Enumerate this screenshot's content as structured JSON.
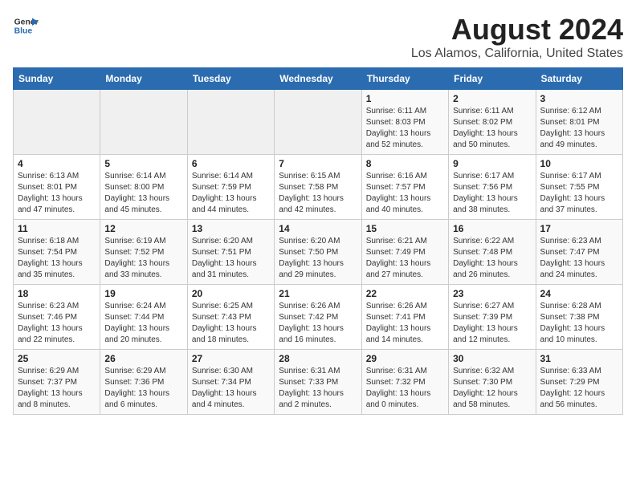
{
  "logo": {
    "line1": "General",
    "line2": "Blue"
  },
  "title": "August 2024",
  "subtitle": "Los Alamos, California, United States",
  "weekdays": [
    "Sunday",
    "Monday",
    "Tuesday",
    "Wednesday",
    "Thursday",
    "Friday",
    "Saturday"
  ],
  "weeks": [
    [
      {
        "day": "",
        "info": ""
      },
      {
        "day": "",
        "info": ""
      },
      {
        "day": "",
        "info": ""
      },
      {
        "day": "",
        "info": ""
      },
      {
        "day": "1",
        "info": "Sunrise: 6:11 AM\nSunset: 8:03 PM\nDaylight: 13 hours\nand 52 minutes."
      },
      {
        "day": "2",
        "info": "Sunrise: 6:11 AM\nSunset: 8:02 PM\nDaylight: 13 hours\nand 50 minutes."
      },
      {
        "day": "3",
        "info": "Sunrise: 6:12 AM\nSunset: 8:01 PM\nDaylight: 13 hours\nand 49 minutes."
      }
    ],
    [
      {
        "day": "4",
        "info": "Sunrise: 6:13 AM\nSunset: 8:01 PM\nDaylight: 13 hours\nand 47 minutes."
      },
      {
        "day": "5",
        "info": "Sunrise: 6:14 AM\nSunset: 8:00 PM\nDaylight: 13 hours\nand 45 minutes."
      },
      {
        "day": "6",
        "info": "Sunrise: 6:14 AM\nSunset: 7:59 PM\nDaylight: 13 hours\nand 44 minutes."
      },
      {
        "day": "7",
        "info": "Sunrise: 6:15 AM\nSunset: 7:58 PM\nDaylight: 13 hours\nand 42 minutes."
      },
      {
        "day": "8",
        "info": "Sunrise: 6:16 AM\nSunset: 7:57 PM\nDaylight: 13 hours\nand 40 minutes."
      },
      {
        "day": "9",
        "info": "Sunrise: 6:17 AM\nSunset: 7:56 PM\nDaylight: 13 hours\nand 38 minutes."
      },
      {
        "day": "10",
        "info": "Sunrise: 6:17 AM\nSunset: 7:55 PM\nDaylight: 13 hours\nand 37 minutes."
      }
    ],
    [
      {
        "day": "11",
        "info": "Sunrise: 6:18 AM\nSunset: 7:54 PM\nDaylight: 13 hours\nand 35 minutes."
      },
      {
        "day": "12",
        "info": "Sunrise: 6:19 AM\nSunset: 7:52 PM\nDaylight: 13 hours\nand 33 minutes."
      },
      {
        "day": "13",
        "info": "Sunrise: 6:20 AM\nSunset: 7:51 PM\nDaylight: 13 hours\nand 31 minutes."
      },
      {
        "day": "14",
        "info": "Sunrise: 6:20 AM\nSunset: 7:50 PM\nDaylight: 13 hours\nand 29 minutes."
      },
      {
        "day": "15",
        "info": "Sunrise: 6:21 AM\nSunset: 7:49 PM\nDaylight: 13 hours\nand 27 minutes."
      },
      {
        "day": "16",
        "info": "Sunrise: 6:22 AM\nSunset: 7:48 PM\nDaylight: 13 hours\nand 26 minutes."
      },
      {
        "day": "17",
        "info": "Sunrise: 6:23 AM\nSunset: 7:47 PM\nDaylight: 13 hours\nand 24 minutes."
      }
    ],
    [
      {
        "day": "18",
        "info": "Sunrise: 6:23 AM\nSunset: 7:46 PM\nDaylight: 13 hours\nand 22 minutes."
      },
      {
        "day": "19",
        "info": "Sunrise: 6:24 AM\nSunset: 7:44 PM\nDaylight: 13 hours\nand 20 minutes."
      },
      {
        "day": "20",
        "info": "Sunrise: 6:25 AM\nSunset: 7:43 PM\nDaylight: 13 hours\nand 18 minutes."
      },
      {
        "day": "21",
        "info": "Sunrise: 6:26 AM\nSunset: 7:42 PM\nDaylight: 13 hours\nand 16 minutes."
      },
      {
        "day": "22",
        "info": "Sunrise: 6:26 AM\nSunset: 7:41 PM\nDaylight: 13 hours\nand 14 minutes."
      },
      {
        "day": "23",
        "info": "Sunrise: 6:27 AM\nSunset: 7:39 PM\nDaylight: 13 hours\nand 12 minutes."
      },
      {
        "day": "24",
        "info": "Sunrise: 6:28 AM\nSunset: 7:38 PM\nDaylight: 13 hours\nand 10 minutes."
      }
    ],
    [
      {
        "day": "25",
        "info": "Sunrise: 6:29 AM\nSunset: 7:37 PM\nDaylight: 13 hours\nand 8 minutes."
      },
      {
        "day": "26",
        "info": "Sunrise: 6:29 AM\nSunset: 7:36 PM\nDaylight: 13 hours\nand 6 minutes."
      },
      {
        "day": "27",
        "info": "Sunrise: 6:30 AM\nSunset: 7:34 PM\nDaylight: 13 hours\nand 4 minutes."
      },
      {
        "day": "28",
        "info": "Sunrise: 6:31 AM\nSunset: 7:33 PM\nDaylight: 13 hours\nand 2 minutes."
      },
      {
        "day": "29",
        "info": "Sunrise: 6:31 AM\nSunset: 7:32 PM\nDaylight: 13 hours\nand 0 minutes."
      },
      {
        "day": "30",
        "info": "Sunrise: 6:32 AM\nSunset: 7:30 PM\nDaylight: 12 hours\nand 58 minutes."
      },
      {
        "day": "31",
        "info": "Sunrise: 6:33 AM\nSunset: 7:29 PM\nDaylight: 12 hours\nand 56 minutes."
      }
    ]
  ]
}
